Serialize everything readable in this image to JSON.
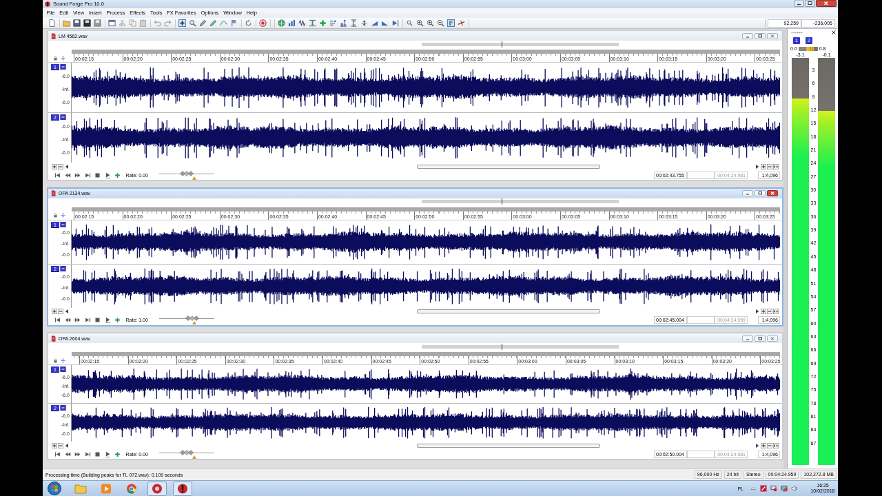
{
  "window": {
    "title": "Sound Forge Pro 10.0"
  },
  "menu": [
    "File",
    "Edit",
    "View",
    "Insert",
    "Process",
    "Effects",
    "Tools",
    "FX Favorites",
    "Options",
    "Window",
    "Help"
  ],
  "toolbar": {
    "fields": [
      "92,259",
      "-236,005"
    ]
  },
  "data_windows": [
    {
      "title": "LM 4562.wav",
      "active": false,
      "ruler": [
        "00:02:15",
        "00:02:20",
        "00:02:25",
        "00:02:30",
        "00:02:35",
        "00:02:40",
        "00:02:45",
        "00:02:50",
        "00:02:55",
        "00:03:00",
        "00:03:05",
        "00:03:10",
        "00:03:15",
        "00:03:20",
        "00:03:25"
      ],
      "channels": [
        {
          "number": "1",
          "scale": [
            "-6.0",
            "-Inf.",
            "-6.0"
          ]
        },
        {
          "number": "2",
          "scale": [
            "-6.0",
            "-Inf.",
            "-6.0"
          ]
        }
      ],
      "rate": "Rate: 0.00",
      "rate_slider": {
        "level": 0.5
      },
      "fields": [
        {
          "value": "00:02:43.755",
          "dimmed": false
        },
        {
          "value": "00:04:24.981",
          "dimmed": true
        },
        {
          "value": "1:4,096",
          "dimmed": false
        }
      ]
    },
    {
      "title": "OPA 2134.wav",
      "active": true,
      "ruler": [
        "00:02:15",
        "00:02:20",
        "00:02:25",
        "00:02:30",
        "00:02:35",
        "00:02:40",
        "00:02:45",
        "00:02:50",
        "00:02:55",
        "00:03:00",
        "00:03:05",
        "00:03:10",
        "00:03:15",
        "00:03:20",
        "00:03:25"
      ],
      "channels": [
        {
          "number": "1",
          "scale": [
            "-6.0",
            "-Inf.",
            "-6.0"
          ]
        },
        {
          "number": "2",
          "scale": [
            "-6.0",
            "-Inf.",
            "-6.0"
          ]
        }
      ],
      "rate": "Rate: 1.00",
      "rate_slider": {
        "level": 0.6
      },
      "fields": [
        {
          "value": "00:02:45.004",
          "dimmed": false
        },
        {
          "value": "00:04:24.959",
          "dimmed": true
        },
        {
          "value": "1:4,096",
          "dimmed": false
        }
      ]
    },
    {
      "title": "OPA 2604.wav",
      "active": false,
      "ruler": [
        "00:02:15",
        "00:02:20",
        "00:02:25",
        "00:02:30",
        "00:02:35",
        "00:02:40",
        "00:02:45",
        "00:02:50",
        "00:02:55",
        "00:03:00",
        "00:03:05",
        "00:03:10",
        "00:03:15",
        "00:03:20",
        "00:03:25"
      ],
      "channels": [
        {
          "number": "1",
          "scale": [
            "-6.0",
            "-Inf.",
            "-6.0"
          ]
        },
        {
          "number": "2",
          "scale": [
            "-6.0",
            "-Inf.",
            "-6.0"
          ]
        }
      ],
      "rate": "Rate: 0.00",
      "rate_slider": {
        "level": 0.5
      },
      "fields": [
        {
          "value": "00:02:50.004",
          "dimmed": false
        },
        {
          "value": "00:04:24.981",
          "dimmed": true
        },
        {
          "value": "1:4,096",
          "dimmed": false
        }
      ]
    }
  ],
  "meter": {
    "channel_buttons": [
      "1",
      "2"
    ],
    "gauge": [
      "0.0",
      "0.8"
    ],
    "peaks": [
      "-3.1",
      "-0.1"
    ],
    "bars": [
      {
        "level": 0.9
      },
      {
        "level": 0.87
      }
    ],
    "scale": [
      "3",
      "6",
      "9",
      "12",
      "15",
      "18",
      "21",
      "24",
      "27",
      "30",
      "33",
      "36",
      "39",
      "42",
      "45",
      "48",
      "51",
      "54",
      "57",
      "60",
      "63",
      "66",
      "69",
      "72",
      "75",
      "78",
      "81",
      "84",
      "87"
    ]
  },
  "status_bar": {
    "message": "Processing time (Building peaks for TL 072.wav): 0.109 seconds",
    "cells": [
      "96,000 Hz",
      "24 bit",
      "Stereo",
      "00:04:24.959",
      "102,272.8 MB"
    ]
  },
  "taskbar": {
    "language": "PL",
    "time": "16:25",
    "date": "10/02/2018"
  }
}
